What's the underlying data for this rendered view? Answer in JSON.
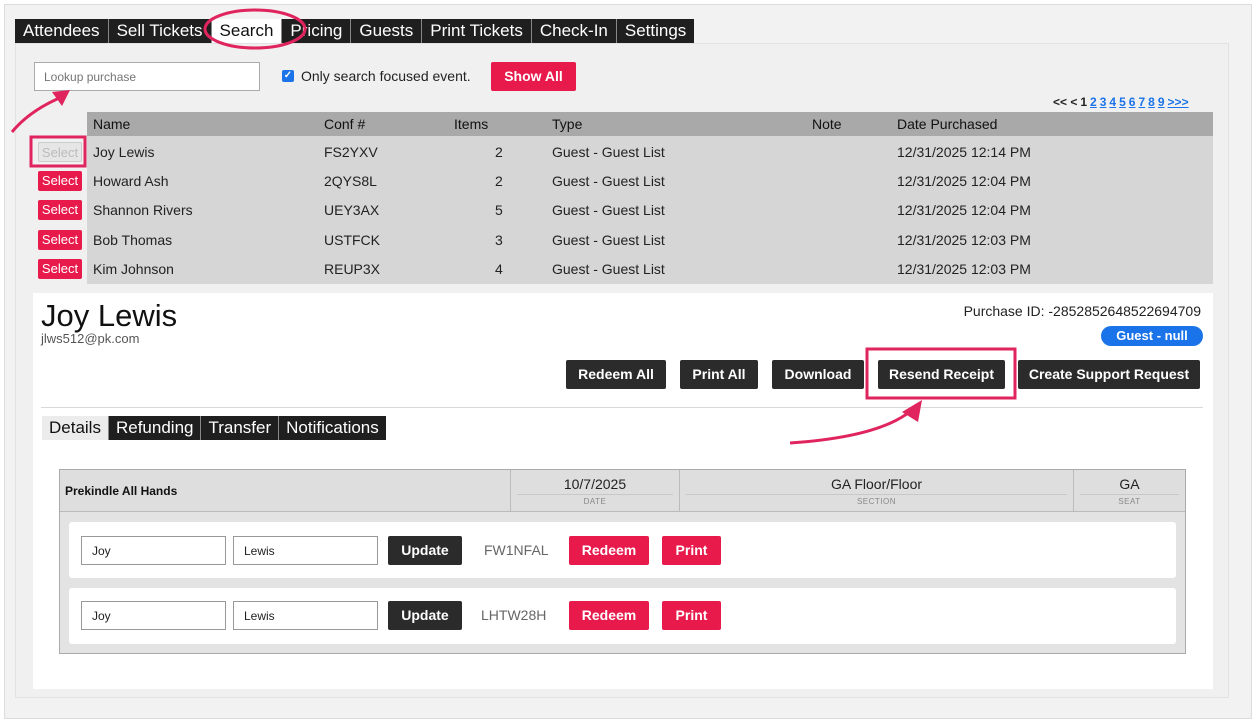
{
  "nav": {
    "tabs": [
      "Attendees",
      "Sell Tickets",
      "Search",
      "Pricing",
      "Guests",
      "Print Tickets",
      "Check-In",
      "Settings"
    ],
    "active": "Search"
  },
  "search": {
    "placeholder": "Lookup purchase",
    "only_focused_label": "Only search focused event.",
    "only_focused_checked": true,
    "show_all_label": "Show All"
  },
  "pager": {
    "prefix": "<< <",
    "current": "1",
    "pages": [
      "2",
      "3",
      "4",
      "5",
      "6",
      "7",
      "8",
      "9"
    ],
    "next": ">>>"
  },
  "results": {
    "headers": {
      "name": "Name",
      "conf": "Conf #",
      "items": "Items",
      "type": "Type",
      "note": "Note",
      "date": "Date Purchased"
    },
    "select_label": "Select",
    "rows": [
      {
        "name": "Joy Lewis",
        "conf": "FS2YXV",
        "items": "2",
        "type": "Guest - Guest List",
        "note": "",
        "date": "12/31/2025 12:14 PM",
        "selected": true
      },
      {
        "name": "Howard Ash",
        "conf": "2QYS8L",
        "items": "2",
        "type": "Guest - Guest List",
        "note": "",
        "date": "12/31/2025 12:04 PM",
        "selected": false
      },
      {
        "name": "Shannon Rivers",
        "conf": "UEY3AX",
        "items": "5",
        "type": "Guest - Guest List",
        "note": "",
        "date": "12/31/2025 12:04 PM",
        "selected": false
      },
      {
        "name": "Bob Thomas",
        "conf": "USTFCK",
        "items": "3",
        "type": "Guest - Guest List",
        "note": "",
        "date": "12/31/2025 12:03 PM",
        "selected": false
      },
      {
        "name": "Kim Johnson",
        "conf": "REUP3X",
        "items": "4",
        "type": "Guest - Guest List",
        "note": "",
        "date": "12/31/2025 12:03 PM",
        "selected": false
      }
    ]
  },
  "purchase": {
    "name": "Joy Lewis",
    "email": "jlws512@pk.com",
    "purchase_id": "Purchase ID: -2852852648522694709",
    "badge": "Guest - null",
    "actions": {
      "redeem_all": "Redeem All",
      "print_all": "Print All",
      "download": "Download",
      "resend_receipt": "Resend Receipt",
      "support": "Create Support Request"
    },
    "subtabs": [
      "Details",
      "Refunding",
      "Transfer",
      "Notifications"
    ],
    "active_subtab": "Details"
  },
  "tickets": {
    "event": "Prekindle All Hands",
    "date": "10/7/2025",
    "date_label": "DATE",
    "section": "GA Floor/Floor",
    "section_label": "SECTION",
    "seat": "GA",
    "seat_label": "SEAT",
    "update_label": "Update",
    "redeem_label": "Redeem",
    "print_label": "Print",
    "items": [
      {
        "first": "Joy",
        "last": "Lewis",
        "code": "FW1NFAL"
      },
      {
        "first": "Joy",
        "last": "Lewis",
        "code": "LHTW28H"
      }
    ]
  },
  "colors": {
    "accent_red": "#e8194b",
    "dark": "#2b2b2b",
    "blue": "#1a73e8",
    "annotation": "#e0245e"
  }
}
